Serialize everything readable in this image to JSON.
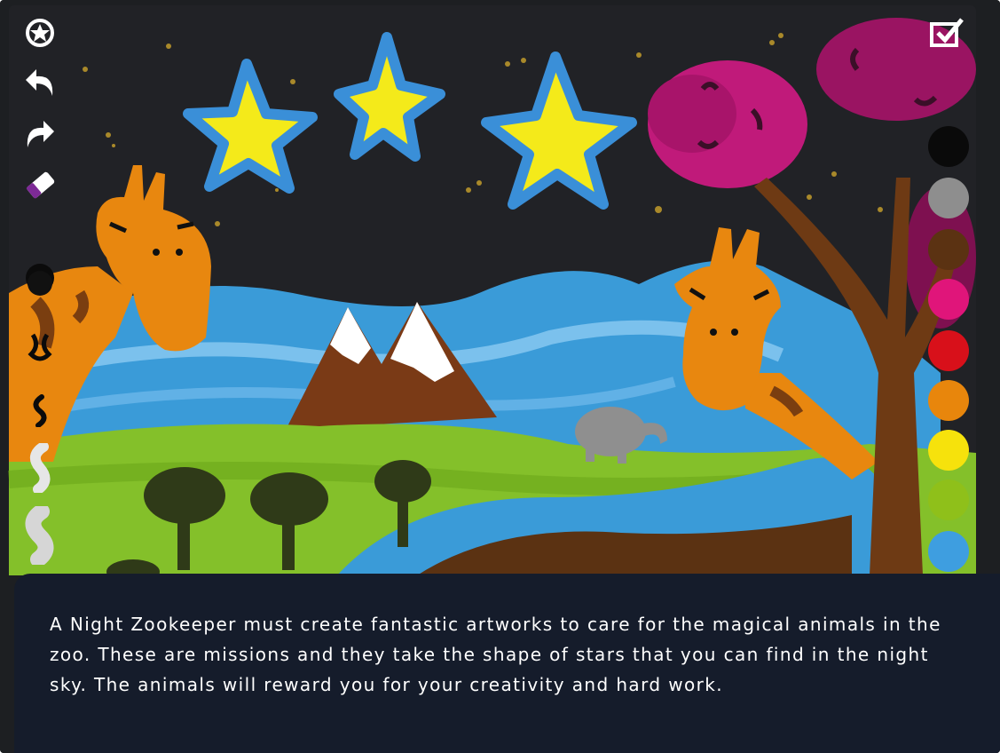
{
  "info": {
    "text": "A Night Zookeeper must create fantastic artworks to care for the magical animals in the zoo. These are missions and they take the shape of stars that you can find in the night sky. The animals will reward you for your creativity and hard work."
  },
  "toolbar": {
    "tools": [
      "magic-wand-icon",
      "undo-icon",
      "redo-icon",
      "eraser-icon"
    ],
    "brushes": [
      "brush-size-1",
      "brush-size-2",
      "brush-size-3",
      "brush-size-4",
      "brush-size-5"
    ]
  },
  "palette": {
    "colors": [
      "#0a0a0a",
      "#8e8e8e",
      "#5b3212",
      "#e0157a",
      "#d8101a",
      "#e8860c",
      "#f6e20c",
      "#8fc01a",
      "#3e9ee0"
    ]
  },
  "done_icon": "checkbox-done-icon"
}
